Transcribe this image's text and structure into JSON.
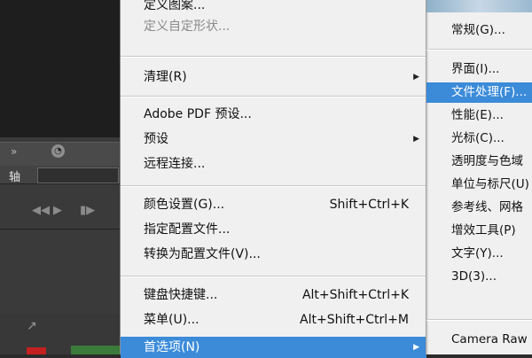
{
  "background_panel": {
    "field_label": "轴"
  },
  "menu": {
    "items": [
      {
        "label": "定义图案...",
        "shortcut": "",
        "submenu": false,
        "disabled": false
      },
      {
        "label": "定义自定形状...",
        "shortcut": "",
        "submenu": false,
        "disabled": true
      },
      {
        "label": "清理(R)",
        "shortcut": "",
        "submenu": true,
        "disabled": false
      },
      {
        "label": "Adobe PDF 预设...",
        "shortcut": "",
        "submenu": false,
        "disabled": false
      },
      {
        "label": "预设",
        "shortcut": "",
        "submenu": true,
        "disabled": false
      },
      {
        "label": "远程连接...",
        "shortcut": "",
        "submenu": false,
        "disabled": false
      },
      {
        "label": "颜色设置(G)...",
        "shortcut": "Shift+Ctrl+K",
        "submenu": false,
        "disabled": false
      },
      {
        "label": "指定配置文件...",
        "shortcut": "",
        "submenu": false,
        "disabled": false
      },
      {
        "label": "转换为配置文件(V)...",
        "shortcut": "",
        "submenu": false,
        "disabled": false
      },
      {
        "label": "键盘快捷键...",
        "shortcut": "Alt+Shift+Ctrl+K",
        "submenu": false,
        "disabled": false
      },
      {
        "label": "菜单(U)...",
        "shortcut": "Alt+Shift+Ctrl+M",
        "submenu": false,
        "disabled": false
      },
      {
        "label": "首选项(N)",
        "shortcut": "",
        "submenu": true,
        "disabled": false
      }
    ]
  },
  "submenu": {
    "items": [
      {
        "label": "常规(G)..."
      },
      {
        "label": "界面(I)..."
      },
      {
        "label": "文件处理(F)..."
      },
      {
        "label": "性能(E)..."
      },
      {
        "label": "光标(C)..."
      },
      {
        "label": "透明度与色域"
      },
      {
        "label": "单位与标尺(U)"
      },
      {
        "label": "参考线、网格"
      },
      {
        "label": "增效工具(P)"
      },
      {
        "label": "文字(Y)..."
      },
      {
        "label": "3D(3)..."
      },
      {
        "label": "Camera Raw"
      }
    ]
  },
  "icons": {
    "submenu_arrow": "▶"
  },
  "colors": {
    "highlight": "#3b8bd9",
    "menu_bg": "#f0f0f0",
    "disabled_text": "#8a8a8a"
  }
}
